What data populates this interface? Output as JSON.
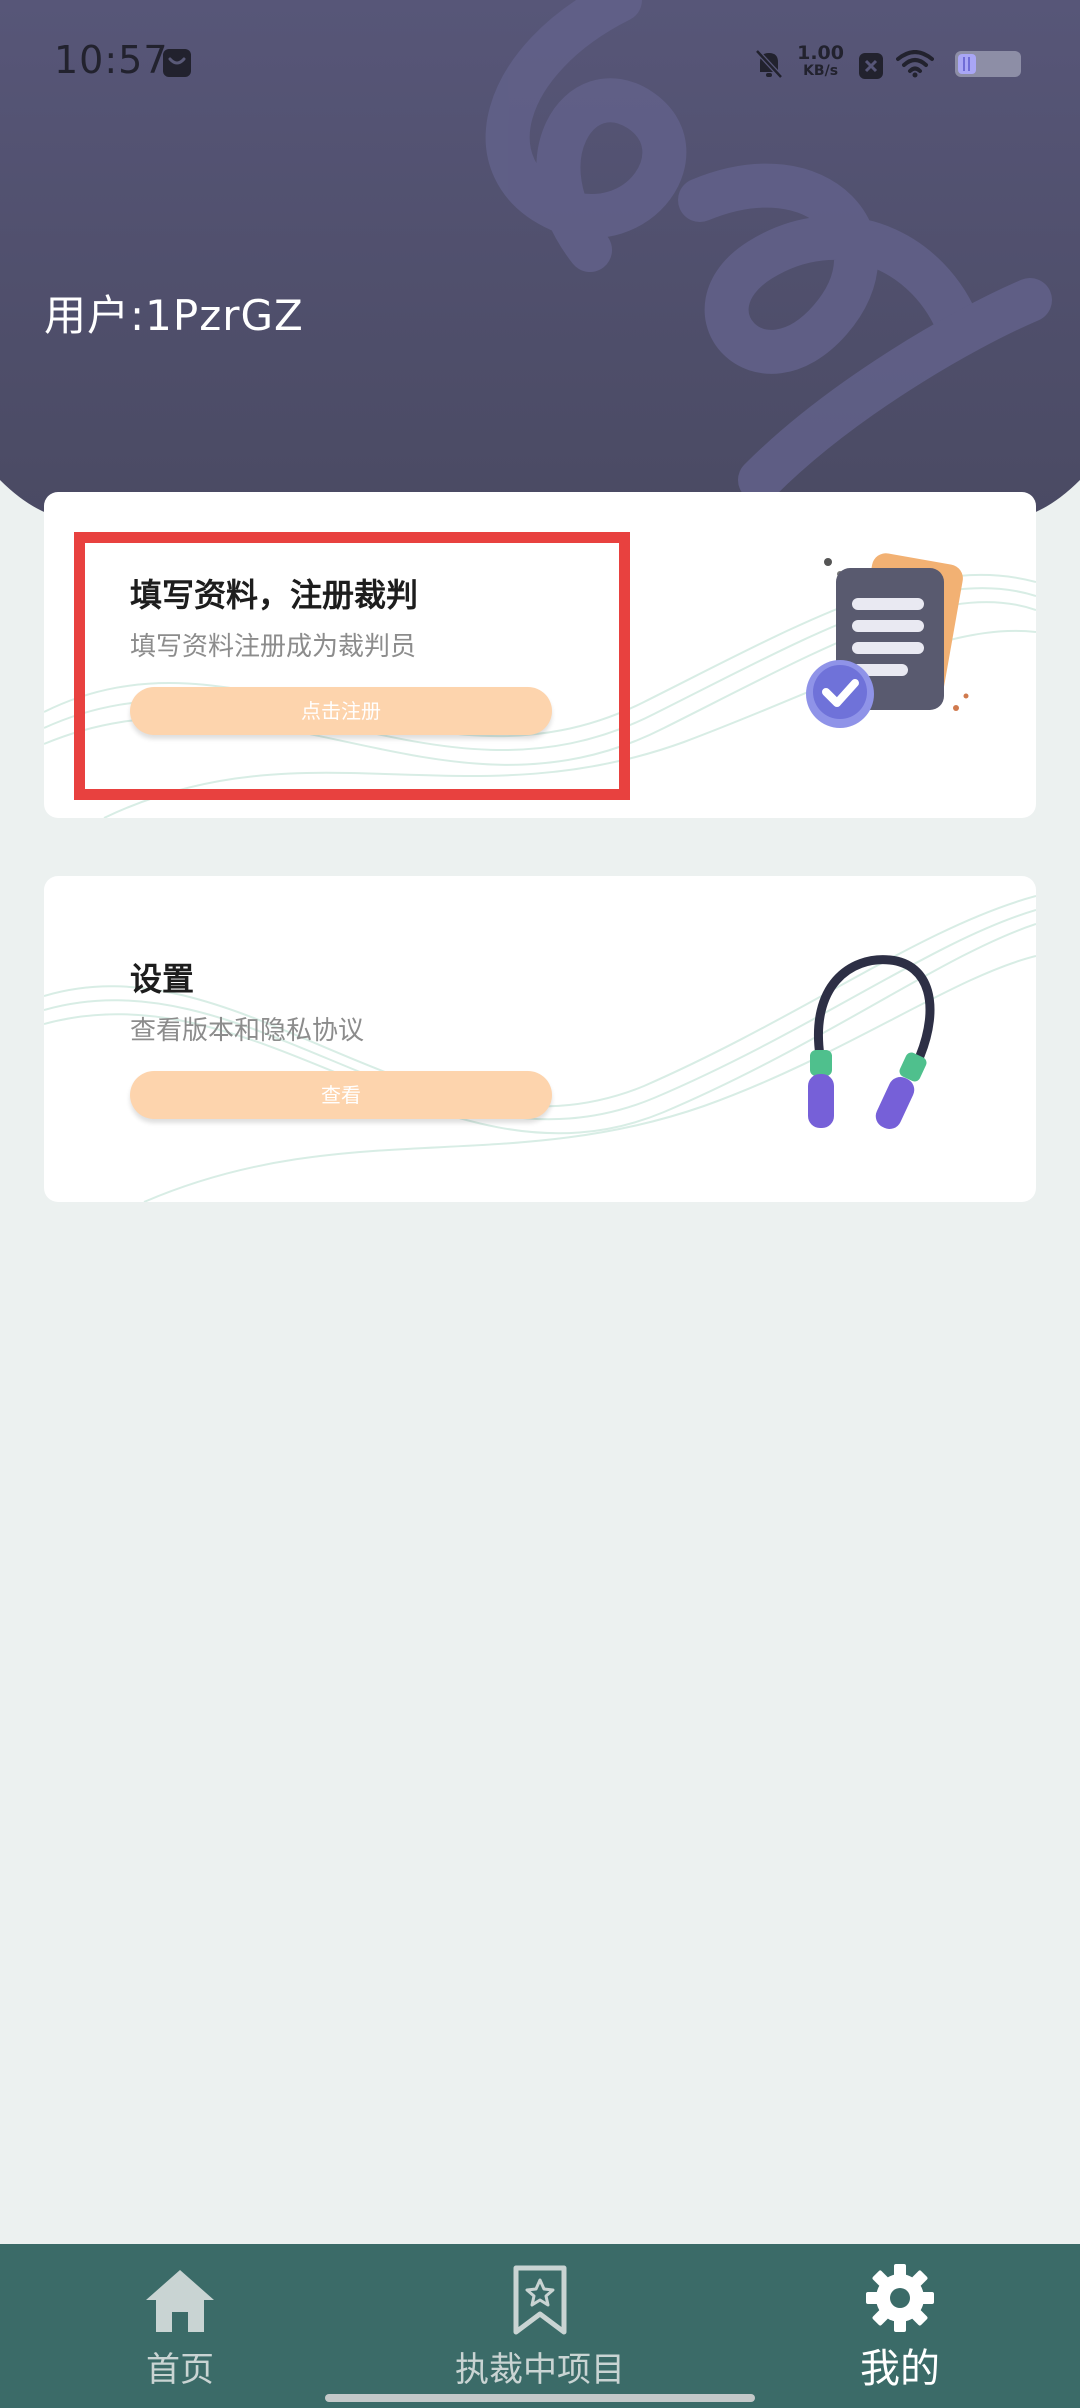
{
  "status_bar": {
    "time": "10:57",
    "speed_value": "1.00",
    "speed_unit": "KB/s",
    "icons": [
      "app-notification-icon",
      "mute-bell-icon",
      "close-box-icon",
      "wifi-icon",
      "battery-icon"
    ]
  },
  "header": {
    "user_label": "用户:1PzrGZ",
    "background_color": "#4e4d6a",
    "accent_color": "#5d5b79"
  },
  "cards": [
    {
      "title": "填写资料，注册裁判",
      "subtitle": "填写资料注册成为裁判员",
      "button_label": "点击注册",
      "art_icon": "document-check-icon",
      "highlighted": true
    },
    {
      "title": "设置",
      "subtitle": "查看版本和隐私协议",
      "button_label": "查看",
      "art_icon": "jump-rope-icon",
      "highlighted": false
    }
  ],
  "colors": {
    "button": "#fdd4ad",
    "highlight": "#e8413f",
    "nav_background": "#3b6b68",
    "page_background": "#ecf1f0"
  },
  "bottom_nav": {
    "items": [
      {
        "label": "首页",
        "icon": "home-icon",
        "active": false
      },
      {
        "label": "执裁中项目",
        "icon": "bookmark-star-icon",
        "active": false
      },
      {
        "label": "我的",
        "icon": "gear-icon",
        "active": true
      }
    ]
  }
}
